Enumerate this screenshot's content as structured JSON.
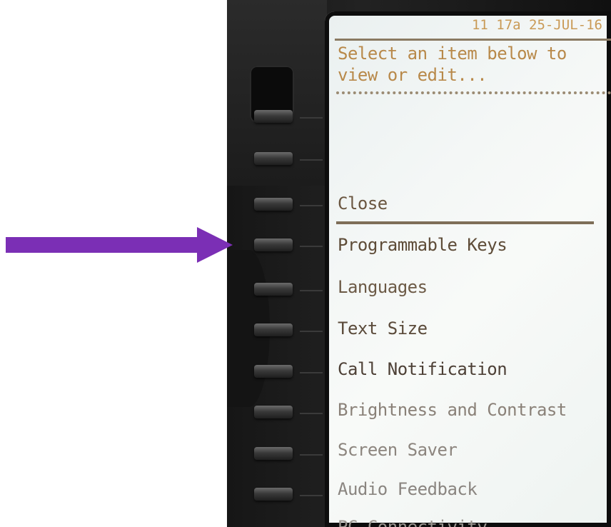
{
  "screen": {
    "clock": "11 17a 25-JUL-16",
    "prompt": "Select an item below to view or edit...",
    "menu": [
      {
        "label": "Close",
        "color": "#6a5640"
      },
      {
        "label": "Programmable Keys",
        "color": "#5e4c38"
      },
      {
        "label": "Languages",
        "color": "#6c5a46"
      },
      {
        "label": "Text Size",
        "color": "#5a4a3a"
      },
      {
        "label": "Call Notification",
        "color": "#4d4036"
      },
      {
        "label": "Brightness and Contrast",
        "color": "#8a8178"
      },
      {
        "label": "Screen Saver",
        "color": "#8c857e"
      },
      {
        "label": "Audio Feedback",
        "color": "#8a8580"
      },
      {
        "label": "PC Connectivity",
        "color": "#9a9690"
      }
    ]
  },
  "annotation": {
    "arrow_color": "#7b2fb5"
  },
  "phone": {
    "line_key_count": 10
  }
}
